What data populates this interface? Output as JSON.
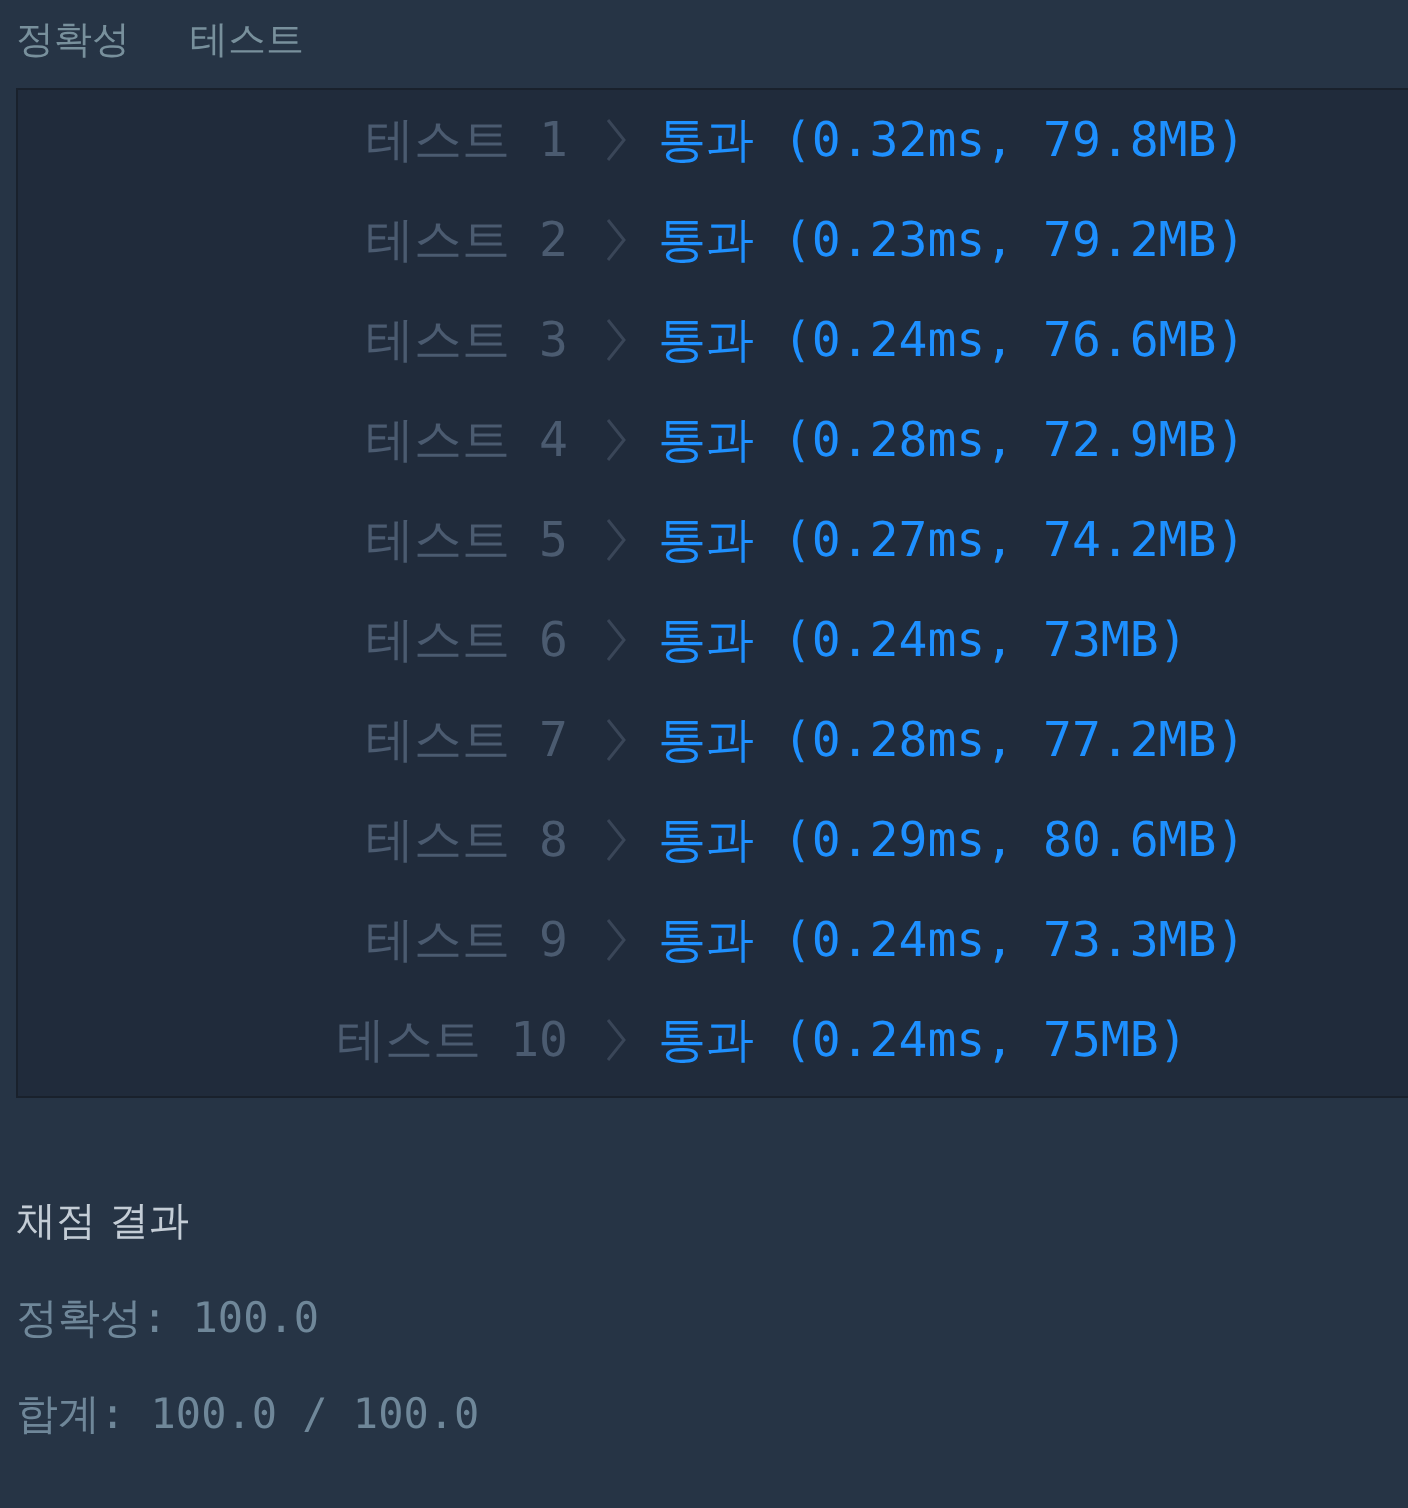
{
  "header": {
    "labels": [
      "정확성",
      "테스트"
    ]
  },
  "tests": [
    {
      "label": "테스트 1",
      "result": "통과 (0.32ms, 79.8MB)"
    },
    {
      "label": "테스트 2",
      "result": "통과 (0.23ms, 79.2MB)"
    },
    {
      "label": "테스트 3",
      "result": "통과 (0.24ms, 76.6MB)"
    },
    {
      "label": "테스트 4",
      "result": "통과 (0.28ms, 72.9MB)"
    },
    {
      "label": "테스트 5",
      "result": "통과 (0.27ms, 74.2MB)"
    },
    {
      "label": "테스트 6",
      "result": "통과 (0.24ms, 73MB)"
    },
    {
      "label": "테스트 7",
      "result": "통과 (0.28ms, 77.2MB)"
    },
    {
      "label": "테스트 8",
      "result": "통과 (0.29ms, 80.6MB)"
    },
    {
      "label": "테스트 9",
      "result": "통과 (0.24ms, 73.3MB)"
    },
    {
      "label": "테스트 10",
      "result": "통과 (0.24ms, 75MB)"
    }
  ],
  "summary": {
    "title": "채점 결과",
    "lines": [
      "정확성: 100.0",
      "합계: 100.0 / 100.0"
    ]
  }
}
